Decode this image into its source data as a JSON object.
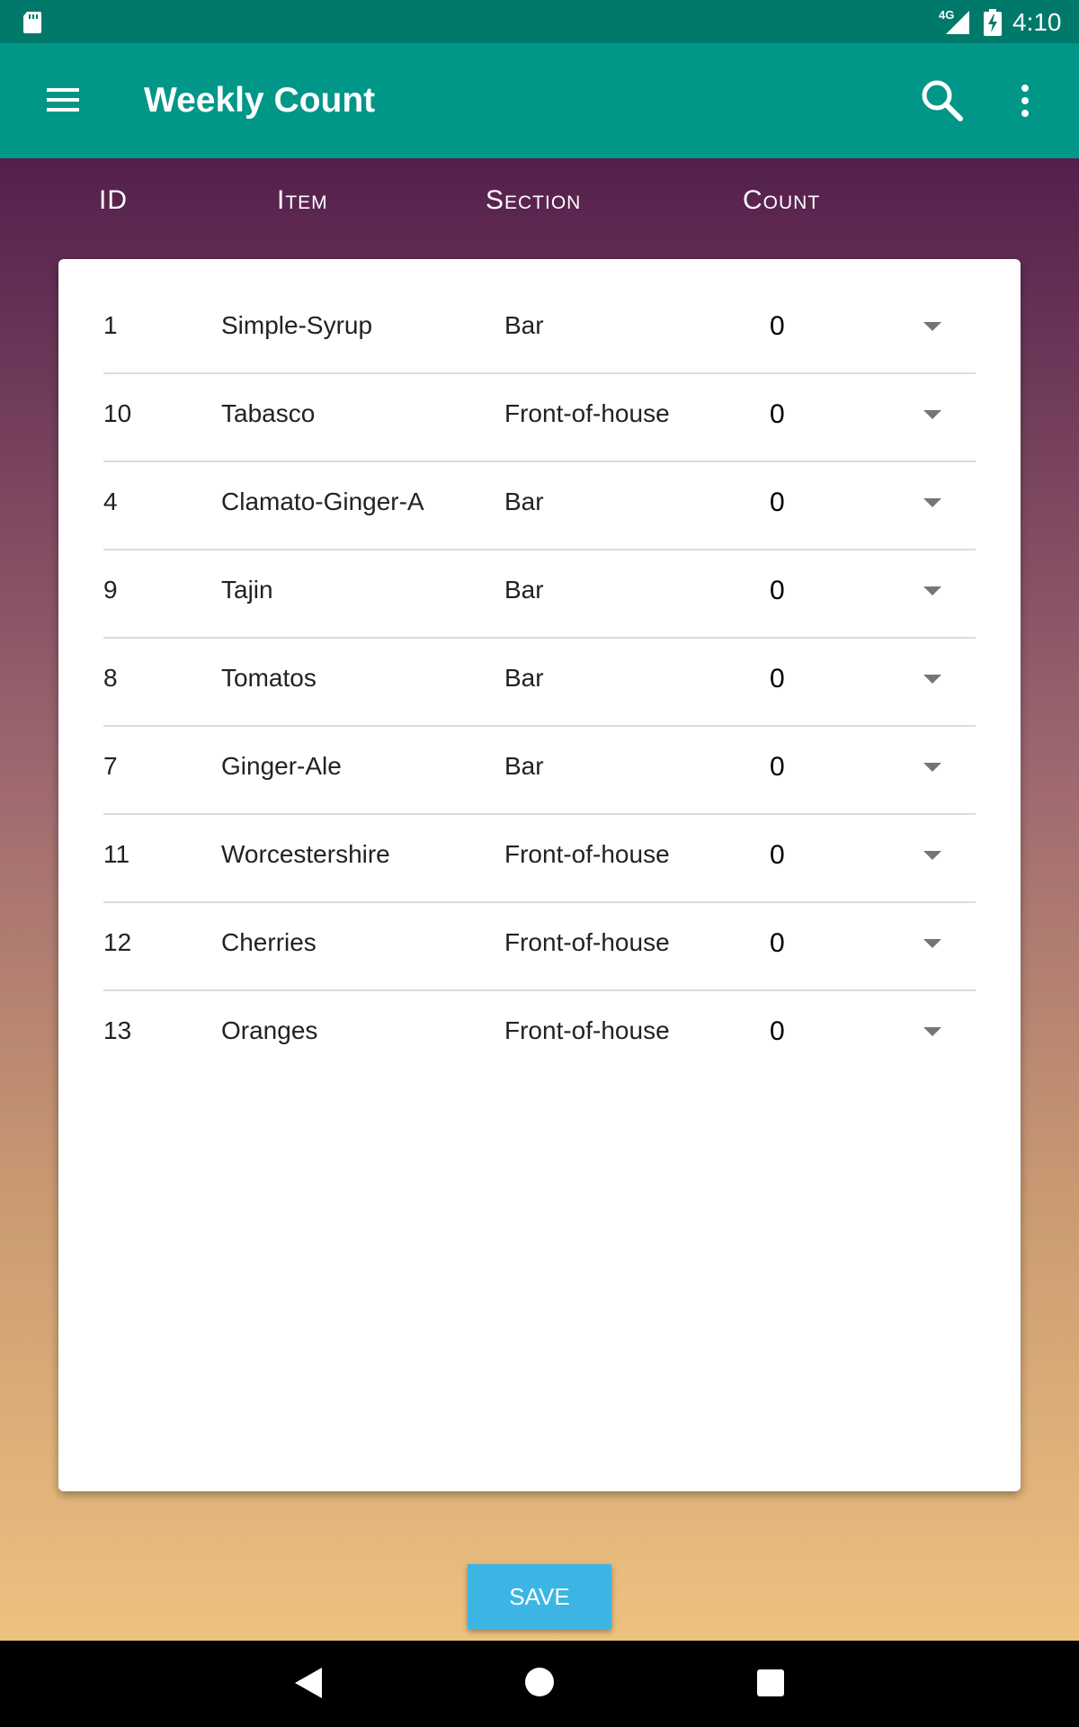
{
  "status_bar": {
    "network": "4G",
    "time": "4:10",
    "icons": [
      "sd-card-icon",
      "signal-icon",
      "battery-charging-icon"
    ]
  },
  "app_bar": {
    "title": "Weekly Count",
    "icons": [
      "menu-icon",
      "search-icon",
      "more-vert-icon"
    ]
  },
  "table": {
    "headers": [
      "ID",
      "Item",
      "Section",
      "Count"
    ],
    "rows": [
      {
        "id": "1",
        "item": "Simple-Syrup",
        "section": "Bar",
        "count": "0"
      },
      {
        "id": "10",
        "item": "Tabasco",
        "section": "Front-of-house",
        "count": "0"
      },
      {
        "id": "4",
        "item": "Clamato-Ginger-A",
        "section": "Bar",
        "count": "0"
      },
      {
        "id": "9",
        "item": "Tajin",
        "section": "Bar",
        "count": "0"
      },
      {
        "id": "8",
        "item": "Tomatos",
        "section": "Bar",
        "count": "0"
      },
      {
        "id": "7",
        "item": "Ginger-Ale",
        "section": "Bar",
        "count": "0"
      },
      {
        "id": "11",
        "item": "Worcestershire",
        "section": "Front-of-house",
        "count": "0"
      },
      {
        "id": "12",
        "item": "Cherries",
        "section": "Front-of-house",
        "count": "0"
      },
      {
        "id": "13",
        "item": "Oranges",
        "section": "Front-of-house",
        "count": "0"
      }
    ]
  },
  "save_label": "SAVE",
  "colors": {
    "status_bar": "#00796b",
    "app_bar": "#009688",
    "gradient_top": "#541f4c",
    "gradient_bottom": "#edc27f",
    "save_button": "#3cb5e5"
  }
}
